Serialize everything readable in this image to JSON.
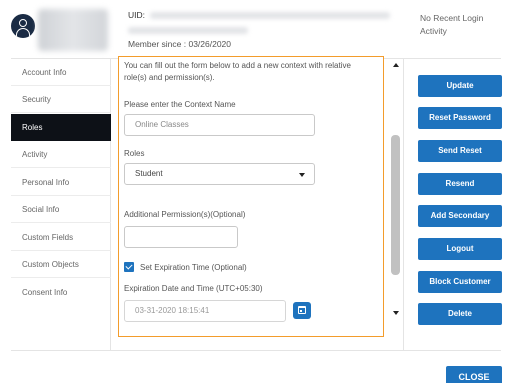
{
  "header": {
    "uid_label": "UID:",
    "member_since": "Member since : 03/26/2020",
    "login_status": "No Recent Login Activity"
  },
  "sidebar": {
    "items": [
      {
        "label": "Account Info"
      },
      {
        "label": "Security"
      },
      {
        "label": "Roles",
        "active": true
      },
      {
        "label": "Activity"
      },
      {
        "label": "Personal Info"
      },
      {
        "label": "Social Info"
      },
      {
        "label": "Custom Fields"
      },
      {
        "label": "Custom Objects"
      },
      {
        "label": "Consent Info"
      }
    ]
  },
  "form": {
    "intro_text": "You can fill out the form below to add a new context with relative role(s) and permission(s).",
    "context_name_label": "Please enter the Context Name",
    "context_name_placeholder": "Online Classes",
    "roles_label": "Roles",
    "roles_selected": "Student",
    "permissions_label": "Additional Permission(s)(Optional)",
    "permissions_value": "",
    "expiration_checkbox_label": "Set Expiration Time (Optional)",
    "expiration_checked": true,
    "expiration_date_label": "Expiration Date and Time (UTC+05:30)",
    "expiration_date_value": "03-31-2020 18:15:41"
  },
  "actions": [
    {
      "label": "Update"
    },
    {
      "label": "Reset Password"
    },
    {
      "label": "Send Reset"
    },
    {
      "label": "Resend"
    },
    {
      "label": "Add Secondary"
    },
    {
      "label": "Logout"
    },
    {
      "label": "Block Customer"
    },
    {
      "label": "Delete"
    }
  ],
  "footer": {
    "close_label": "CLOSE"
  },
  "colors": {
    "accent": "#1e73be",
    "highlight_border": "#f39c2b",
    "active_nav": "#0d1117"
  }
}
